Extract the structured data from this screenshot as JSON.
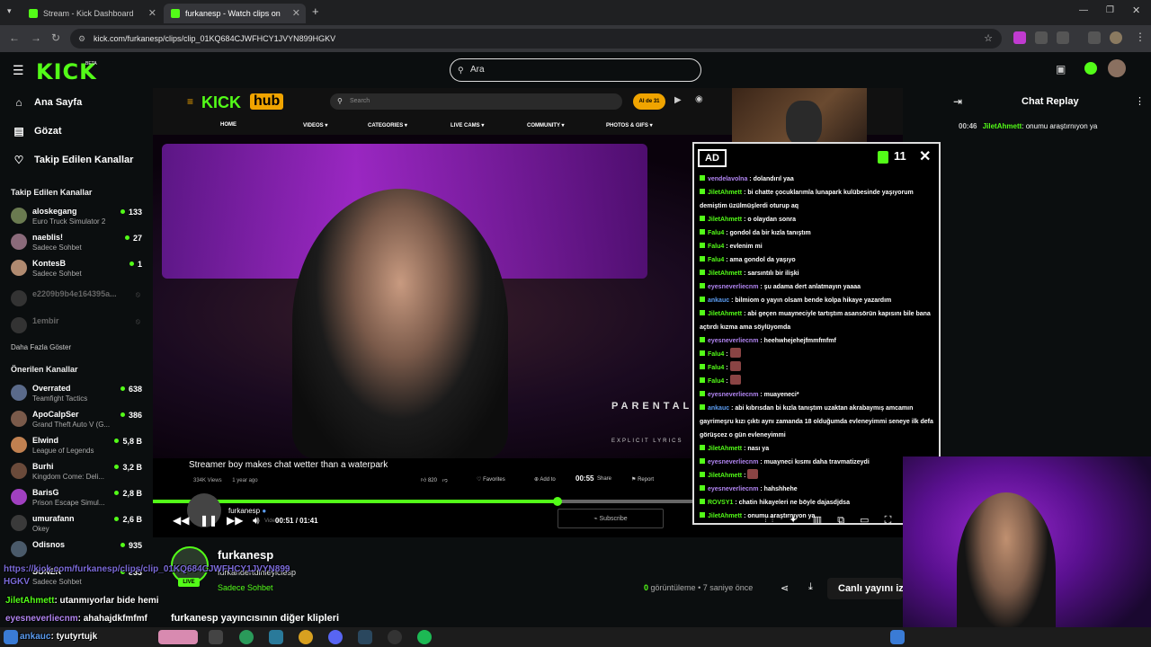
{
  "browser": {
    "tabs": [
      {
        "title": "Stream - Kick Dashboard",
        "active": false
      },
      {
        "title": "furkanesp - Watch clips on",
        "active": true
      }
    ],
    "url": "kick.com/furkanesp/clips/clip_01KQ684CJWFHCY1JVYN899HGKV"
  },
  "header": {
    "logo": "KICK",
    "beta": "BETA",
    "search_placeholder": "Ara"
  },
  "sidebar": {
    "nav": [
      {
        "label": "Ana Sayfa",
        "icon": "home-icon"
      },
      {
        "label": "Gözat",
        "icon": "browse-icon"
      },
      {
        "label": "Takip Edilen Kanallar",
        "icon": "heart-icon"
      }
    ],
    "followed_heading": "Takip Edilen Kanallar",
    "followed": [
      {
        "name": "aloskegang",
        "game": "Euro Truck Simulator 2",
        "viewers": "133"
      },
      {
        "name": "naeblis!",
        "game": "Sadece Sohbet",
        "viewers": "27"
      },
      {
        "name": "KontesB",
        "game": "Sadece Sohbet",
        "viewers": "1"
      },
      {
        "name": "e2209b9b4e164395a...",
        "game": "",
        "viewers": ""
      },
      {
        "name": "1embir",
        "game": "",
        "viewers": ""
      }
    ],
    "show_more": "Daha Fazla Göster",
    "recommended_heading": "Önerilen Kanallar",
    "recommended": [
      {
        "name": "Overrated",
        "game": "Teamfight Tactics",
        "viewers": "638"
      },
      {
        "name": "ApoCalpSer",
        "game": "Grand Theft Auto V (G...",
        "viewers": "386"
      },
      {
        "name": "Elwind",
        "game": "League of Legends",
        "viewers": "5,8 B"
      },
      {
        "name": "Burhi",
        "game": "Kingdom Come: Deli...",
        "viewers": "3,2 B"
      },
      {
        "name": "BarisG",
        "game": "Prison Escape Simul...",
        "viewers": "2,8 B"
      },
      {
        "name": "umurafann",
        "game": "Okey",
        "viewers": "2,6 B"
      },
      {
        "name": "Odisnos",
        "game": "Grand Theft Auto V (G...",
        "viewers": "935"
      }
    ]
  },
  "site": {
    "logo_left": "KICK",
    "logo_right": "hub",
    "search_placeholder": "Search",
    "badge": "AI de 31",
    "nav": [
      "HOME",
      "VIDEOS ▾",
      "CATEGORIES ▾",
      "LIVE CAMS ▾",
      "COMMUNITY ▾",
      "PHOTOS & GIFS ▾"
    ],
    "parental": "PARENTAL",
    "explicit": "EXPLICIT LYRICS",
    "video_title": "Streamer boy makes chat wetter than a waterpark",
    "video_views": "334K Views",
    "video_age": "1 year ago",
    "likes": "820",
    "favorites": "Favorites",
    "add_to": "Add to",
    "share": "Share",
    "report": "Report",
    "subscribe": "Subscribe",
    "uploader": "furkanesp",
    "uploader_sub": "Video"
  },
  "player": {
    "current_time": "00:51",
    "separator": "/",
    "duration": "01:41",
    "hover_time": "00:55",
    "progress": 0.54
  },
  "overlay": {
    "ad": "AD",
    "count": "11",
    "messages": [
      {
        "user": "vendelavolna",
        "color": "purple",
        "text": "dolandırıl yaa"
      },
      {
        "user": "JiletAhmett",
        "color": "green",
        "text": "bi chatte çocuklarımla lunapark kulübesinde yaşıyorum demiştim üzülmüşlerdi oturup aq"
      },
      {
        "user": "JiletAhmett",
        "color": "green",
        "text": "o olaydan sonra"
      },
      {
        "user": "Falu4",
        "color": "green",
        "text": "gondol da bir kızla tanıştım"
      },
      {
        "user": "Falu4",
        "color": "green",
        "text": "evlenim mi"
      },
      {
        "user": "Falu4",
        "color": "green",
        "text": "ama gondol da yaşıyo"
      },
      {
        "user": "JiletAhmett",
        "color": "green",
        "text": "sarsıntılı bir ilişki"
      },
      {
        "user": "eyesneverliecnm",
        "color": "purple",
        "text": "şu adama dert anlatmayın yaaaa"
      },
      {
        "user": "ankauc",
        "color": "blue",
        "text": "bilmiom o yayın olsam bende kolpa hikaye yazardım"
      },
      {
        "user": "JiletAhmett",
        "color": "green",
        "text": "abi geçen muayneciyle tartıştım asansörün kapısını bile bana açtırdı kızma ama söylüyomda"
      },
      {
        "user": "eyesneverliecnm",
        "color": "purple",
        "text": "heehwhejehejfmmfmfmf"
      },
      {
        "user": "Falu4",
        "color": "green",
        "text": ""
      },
      {
        "user": "Falu4",
        "color": "green",
        "text": ""
      },
      {
        "user": "Falu4",
        "color": "green",
        "text": ""
      },
      {
        "user": "eyesneverliecnm",
        "color": "purple",
        "text": "muayeneci*"
      },
      {
        "user": "ankauc",
        "color": "blue",
        "text": "abi kıbrısdan bi kızla tanıştım uzaktan akrabaymış amcamın gayrimeşru kızı çıktı aynı zamanda 18 olduğumda evleneyimmi seneye ilk defa görüşcez o gün evleneyimmi"
      },
      {
        "user": "JiletAhmett",
        "color": "green",
        "text": "nası ya"
      },
      {
        "user": "eyesneverliecnm",
        "color": "purple",
        "text": "muayneci kısmı daha travmatizeydi"
      },
      {
        "user": "JiletAhmett",
        "color": "green",
        "text": ""
      },
      {
        "user": "eyesneverliecnm",
        "color": "purple",
        "text": "hahshhehe"
      },
      {
        "user": "ROVSY1",
        "color": "green",
        "text": "chatin hikayeleri ne böyle dajasdjdsa"
      },
      {
        "user": "JiletAhmett",
        "color": "green",
        "text": "onumu araştırnıyon ya"
      }
    ]
  },
  "chat_replay": {
    "title": "Chat Replay",
    "message": {
      "time": "00:46",
      "user": "JiletAhmett",
      "text": "onumu araştırnıyon ya"
    }
  },
  "channel": {
    "name": "furkanesp",
    "subtitle": "furkandertdinleyiciesp",
    "category": "Sadece Sohbet",
    "live": "LIVE",
    "views_count": "0",
    "views_label": "görüntüleme",
    "age": "7 saniye önce",
    "live_button": "Canlı yayını izle",
    "other_clips": "furkanesp yayıncısının diğer klipleri"
  },
  "stream_overlay": {
    "link_line1": "https://kick.com/furkanesp/clips/clip_01KQ684CJWFHCY1JVYN899",
    "link_line2": "HGKV",
    "chat1_user": "JiletAhmett",
    "chat1_text": ": utanmıyorlar bide hemi",
    "chat2_user": "eyesneverliecnm",
    "chat2_text": ": ahahajdkfmfmf",
    "chat3_user": "ankauc",
    "chat3_text": ": tyutyrtujk",
    "overlap_name": "SONER",
    "overlap_game": "Sadece Sohbet",
    "overlap_viewers": "833"
  },
  "colors": {
    "brand": "#53fc18",
    "background": "#0b0e0f"
  }
}
